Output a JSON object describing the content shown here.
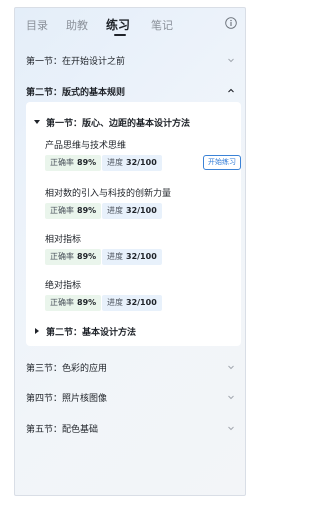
{
  "tabs": [
    {
      "label": "目录"
    },
    {
      "label": "助教"
    },
    {
      "label": "练习"
    },
    {
      "label": "笔记"
    }
  ],
  "sections": [
    {
      "title": "第一节：在开始设计之前",
      "expanded": false
    },
    {
      "title": "第二节：版式的基本规则",
      "expanded": true
    },
    {
      "title": "第三节：色彩的应用",
      "expanded": false
    },
    {
      "title": "第四节：照片核图像",
      "expanded": false
    },
    {
      "title": "第五节：配色基础",
      "expanded": false
    }
  ],
  "subsections": [
    {
      "title": "第一节：版心、边距的基本设计方法",
      "expanded": true
    },
    {
      "title": "第二节：基本设计方法",
      "expanded": false
    }
  ],
  "lessons": [
    {
      "title": "产品思维与技术思维",
      "accuracy_label": "正确率",
      "accuracy": "89%",
      "progress_label": "进度",
      "progress": "32/100",
      "button": "开始练习"
    },
    {
      "title": "相对数的引入与科技的创新力量",
      "accuracy_label": "正确率",
      "accuracy": "89%",
      "progress_label": "进度",
      "progress": "32/100"
    },
    {
      "title": "相对指标",
      "accuracy_label": "正确率",
      "accuracy": "89%",
      "progress_label": "进度",
      "progress": "32/100"
    },
    {
      "title": "绝对指标",
      "accuracy_label": "正确率",
      "accuracy": "89%",
      "progress_label": "进度",
      "progress": "32/100"
    }
  ],
  "colors": {
    "accent": "#2f7ad6",
    "accuracy_bg": "#eaf5ec",
    "progress_bg": "#e8f1fb"
  }
}
